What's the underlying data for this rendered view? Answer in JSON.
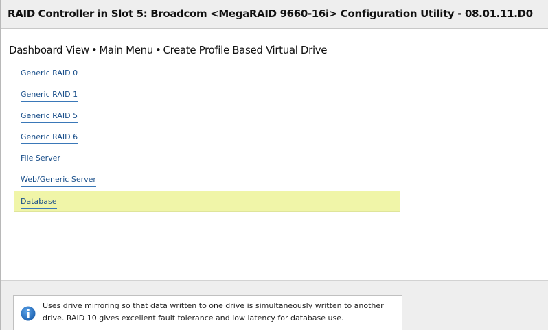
{
  "window": {
    "title": "RAID Controller in Slot 5: Broadcom <MegaRAID 9660-16i> Configuration Utility - 08.01.11.D0"
  },
  "breadcrumb": {
    "items": [
      "Dashboard View",
      "Main Menu",
      "Create Profile Based Virtual Drive"
    ],
    "separator": "•"
  },
  "menu": {
    "items": [
      {
        "label": "Generic RAID 0"
      },
      {
        "label": "Generic RAID 1"
      },
      {
        "label": "Generic RAID 5"
      },
      {
        "label": "Generic RAID 6"
      },
      {
        "label": "File Server"
      },
      {
        "label": "Web/Generic Server"
      },
      {
        "label": "Database",
        "selected": true
      }
    ]
  },
  "help": {
    "icon": "info-icon",
    "text": "Uses drive mirroring so that data written to one drive is simultaneously written to another drive. RAID 10 gives excellent fault tolerance and low latency for database use."
  },
  "colors": {
    "link": "#1a4f8a",
    "selected_highlight": "#f0f5a8",
    "info_icon": "#1e6cc0",
    "panel_background": "#eeeeee"
  }
}
